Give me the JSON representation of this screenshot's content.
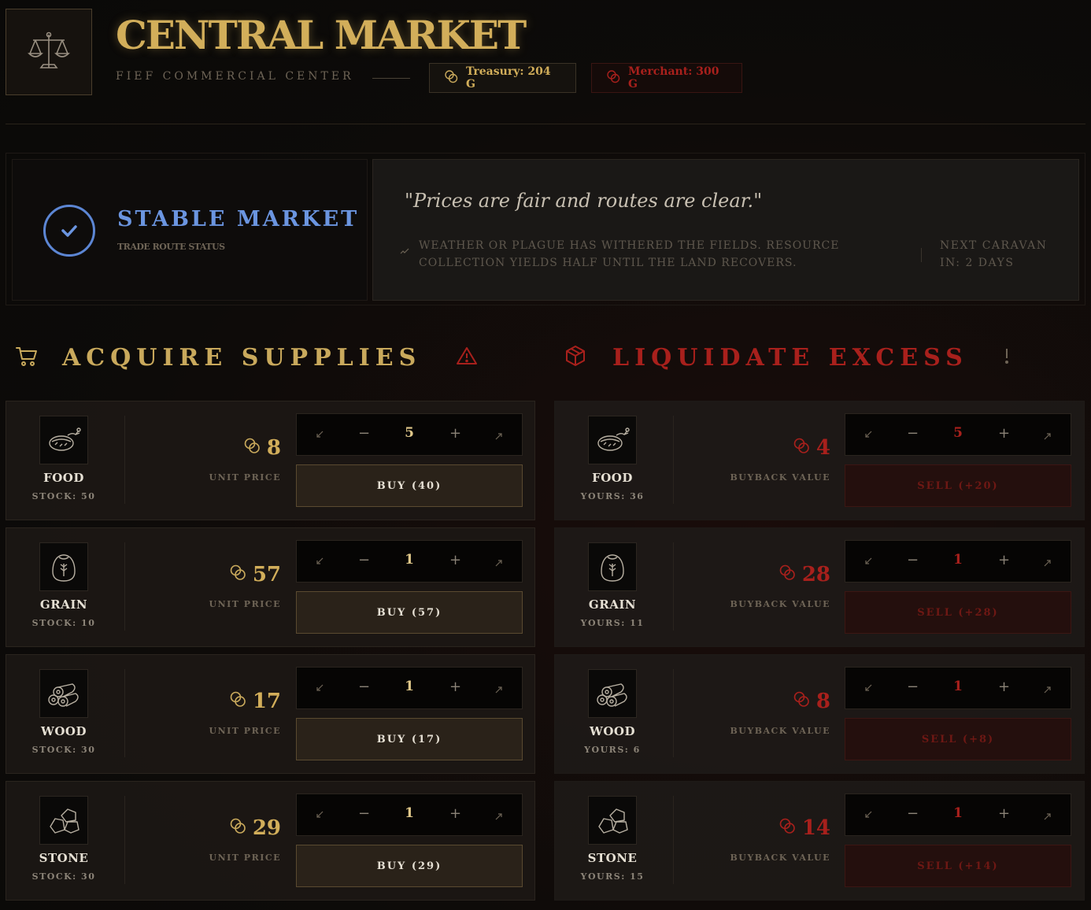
{
  "header": {
    "title": "CENTRAL MARKET",
    "subtitle": "FIEF COMMERCIAL CENTER",
    "treasury": "Treasury: 204 G",
    "merchant": "Merchant: 300 G",
    "logo_icon": "scales-icon",
    "coin_icon": "coins-icon"
  },
  "status": {
    "title": "STABLE MARKET",
    "subtitle": "TRADE ROUTE STATUS",
    "quote": "\"Prices are fair and routes are clear.\"",
    "event": "WEATHER OR PLAGUE HAS WITHERED THE FIELDS. RESOURCE COLLECTION YIELDS HALF UNTIL THE LAND RECOVERS.",
    "caravan_line1": "NEXT CARAVAN",
    "caravan_line2": "IN: 2 DAYS"
  },
  "sections": {
    "buy_title": "ACQUIRE SUPPLIES",
    "sell_title": "LIQUIDATE EXCESS",
    "buy_icon": "cart-icon",
    "sell_icon": "box-icon"
  },
  "buy_rows": [
    {
      "name": "FOOD",
      "stock": "STOCK: 50",
      "price": "8",
      "price_label": "UNIT PRICE",
      "qty": "5",
      "action": "BUY (40)"
    },
    {
      "name": "GRAIN",
      "stock": "STOCK: 10",
      "price": "57",
      "price_label": "UNIT PRICE",
      "qty": "1",
      "action": "BUY (57)"
    },
    {
      "name": "WOOD",
      "stock": "STOCK: 30",
      "price": "17",
      "price_label": "UNIT PRICE",
      "qty": "1",
      "action": "BUY (17)"
    },
    {
      "name": "STONE",
      "stock": "STOCK: 30",
      "price": "29",
      "price_label": "UNIT PRICE",
      "qty": "1",
      "action": "BUY (29)"
    }
  ],
  "sell_rows": [
    {
      "name": "FOOD",
      "stock": "YOURS: 36",
      "price": "4",
      "price_label": "BUYBACK VALUE",
      "qty": "5",
      "action": "SELL (+20)"
    },
    {
      "name": "GRAIN",
      "stock": "YOURS: 11",
      "price": "28",
      "price_label": "BUYBACK VALUE",
      "qty": "1",
      "action": "SELL (+28)"
    },
    {
      "name": "WOOD",
      "stock": "YOURS: 6",
      "price": "8",
      "price_label": "BUYBACK VALUE",
      "qty": "1",
      "action": "SELL (+8)"
    },
    {
      "name": "STONE",
      "stock": "YOURS: 15",
      "price": "14",
      "price_label": "BUYBACK VALUE",
      "qty": "1",
      "action": "SELL (+14)"
    }
  ],
  "stepper": {
    "minus": "−",
    "plus": "+",
    "min": "↙",
    "max": "↗"
  },
  "colors": {
    "gold": "#d2ae5a",
    "crimson": "#a8201c",
    "blue": "#6b95e0"
  }
}
